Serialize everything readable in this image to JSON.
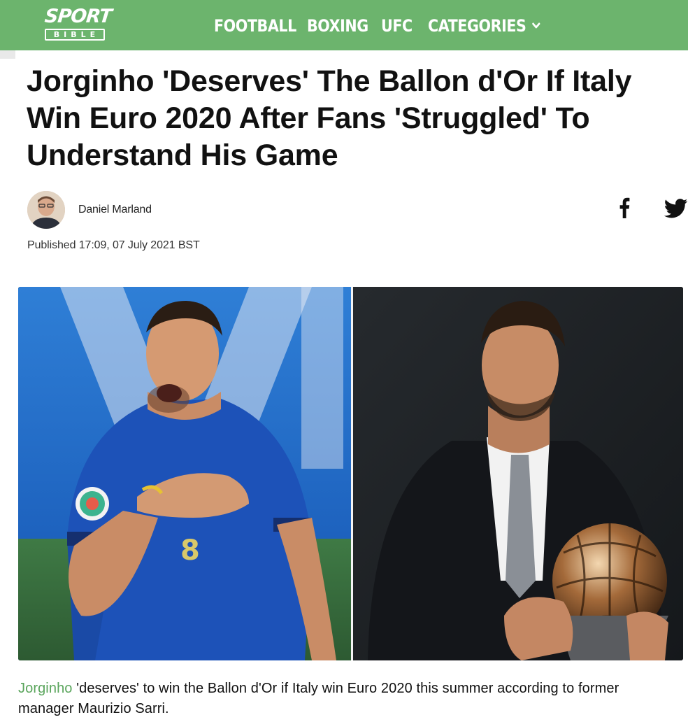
{
  "header": {
    "logo": {
      "top": "SPORT",
      "bottom": "BIBLE"
    },
    "nav": [
      {
        "label": "FOOTBALL"
      },
      {
        "label": "BOXING"
      },
      {
        "label": "UFC"
      },
      {
        "label": "CATEGORIES"
      }
    ],
    "colors": {
      "bar": "#6cb46d",
      "text": "#ffffff"
    }
  },
  "article": {
    "headline": "Jorginho 'Deserves' The Ballon d'Or If Italy Win Euro 2020 After Fans 'Struggled' To Understand His Game",
    "author": "Daniel Marland",
    "published": "Published 17:09, 07 July 2021 BST",
    "share_icons": [
      "facebook-icon",
      "twitter-icon"
    ],
    "caption": {
      "link_text": "Jorginho",
      "rest": " 'deserves' to win the Ballon d'Or if Italy win Euro 2020 this summer according to former manager Maurizio Sarri.",
      "link_color": "#5aa55c"
    }
  }
}
